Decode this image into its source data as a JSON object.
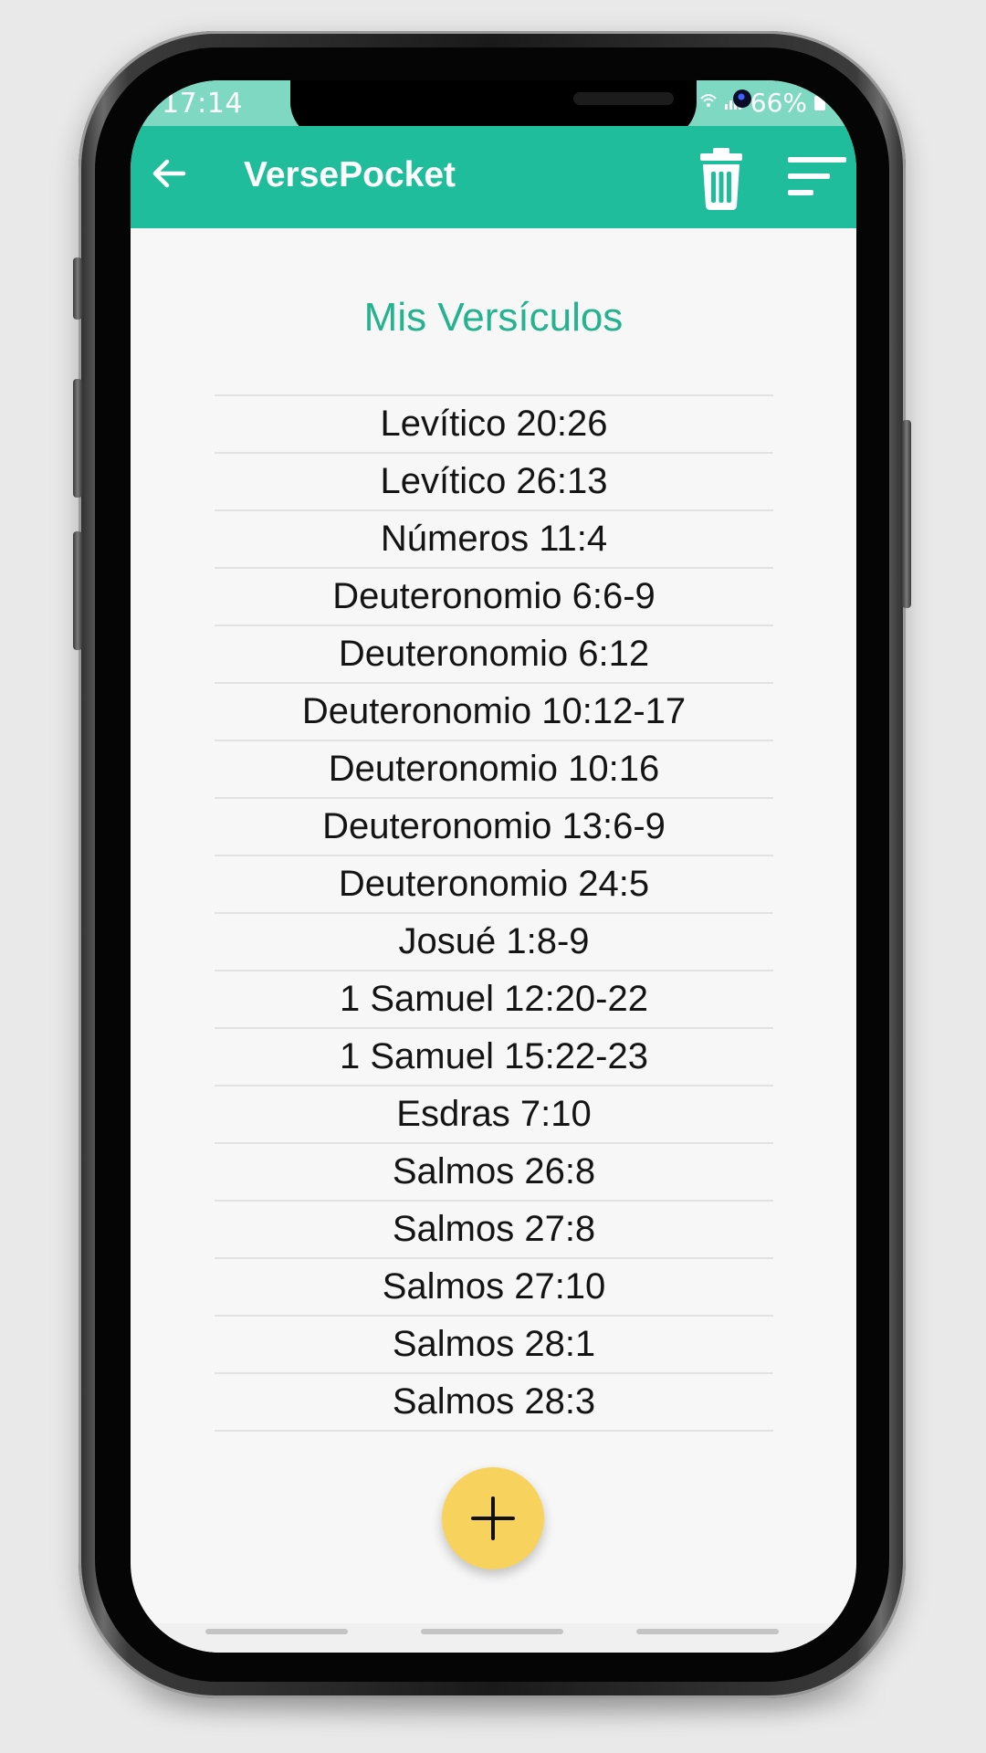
{
  "status_bar": {
    "time": "17:14",
    "signal_icons": "wifi-icon signal-icon",
    "battery": "66%"
  },
  "app_bar": {
    "title": "VersePocket",
    "back_icon": "arrow-left-icon",
    "delete_icon": "trash-icon",
    "sort_icon": "sort-icon",
    "color": "#1fbd9c"
  },
  "main": {
    "title": "Mis Versículos",
    "title_color": "#25b28f",
    "verses": [
      "Levítico 20:26",
      "Levítico 26:13",
      "Números 11:4",
      "Deuteronomio 6:6-9",
      "Deuteronomio 6:12",
      "Deuteronomio 10:12-17",
      "Deuteronomio 10:16",
      "Deuteronomio 13:6-9",
      "Deuteronomio 24:5",
      "Josué 1:8-9",
      "1 Samuel 12:20-22",
      "1 Samuel 15:22-23",
      "Esdras 7:10",
      "Salmos 26:8",
      "Salmos 27:8",
      "Salmos 27:10",
      "Salmos 28:1",
      "Salmos 28:3"
    ]
  },
  "fab": {
    "icon": "plus-icon",
    "color": "#f7d35e"
  }
}
